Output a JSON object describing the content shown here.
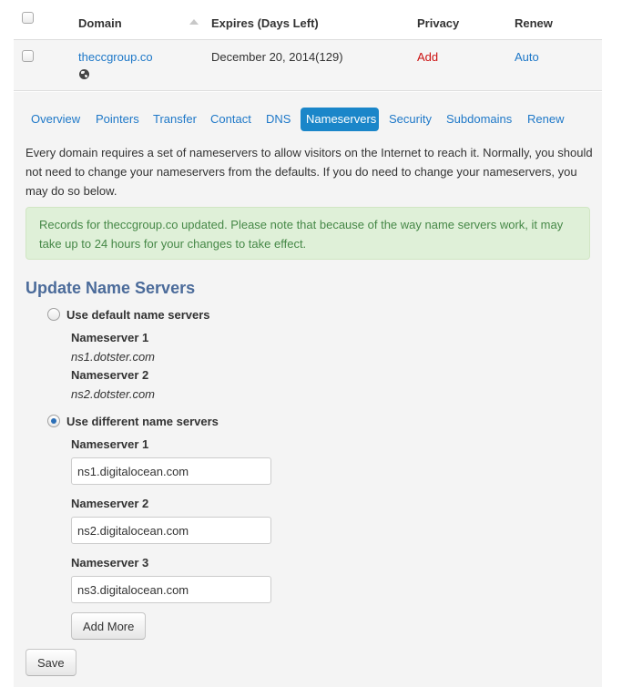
{
  "table": {
    "headers": {
      "domain": "Domain",
      "expires": "Expires (Days Left)",
      "privacy": "Privacy",
      "renew": "Renew"
    },
    "row": {
      "domain": "theccgroup.co",
      "expires": "December 20, 2014(129)",
      "privacy": "Add",
      "renew": "Auto"
    }
  },
  "tabs": [
    {
      "label": "Overview"
    },
    {
      "label": "Pointers"
    },
    {
      "label": "Transfer"
    },
    {
      "label": "Contact"
    },
    {
      "label": "DNS"
    },
    {
      "label": "Nameservers",
      "active": true
    },
    {
      "label": "Security"
    },
    {
      "label": "Subdomains"
    },
    {
      "label": "Renew"
    }
  ],
  "intro_text": "Every domain requires a set of nameservers to allow visitors on the Internet to reach it. Normally, you should not need to change your nameservers from the defaults. If you do need to change your nameservers, you may do so below.",
  "alert_text": "Records for theccgroup.co updated. Please note that because of the way name servers work, it may take up to 24 hours for your changes to take effect.",
  "update": {
    "title": "Update Name Servers",
    "default_option": {
      "label": "Use default name servers",
      "selected": false,
      "servers": [
        {
          "label": "Nameserver 1",
          "value": "ns1.dotster.com"
        },
        {
          "label": "Nameserver 2",
          "value": "ns2.dotster.com"
        }
      ]
    },
    "custom_option": {
      "label": "Use different name servers",
      "selected": true,
      "servers": [
        {
          "label": "Nameserver 1",
          "value": "ns1.digitalocean.com"
        },
        {
          "label": "Nameserver 2",
          "value": "ns2.digitalocean.com"
        },
        {
          "label": "Nameserver 3",
          "value": "ns3.digitalocean.com"
        }
      ]
    },
    "add_more_label": "Add More",
    "save_label": "Save"
  },
  "colors": {
    "link": "#1e78c8",
    "active_tab": "#1a86c9",
    "alert_bg": "#dff0d8",
    "alert_text": "#468847",
    "title": "#4b6b9a",
    "privacy_add": "#cc1111"
  }
}
